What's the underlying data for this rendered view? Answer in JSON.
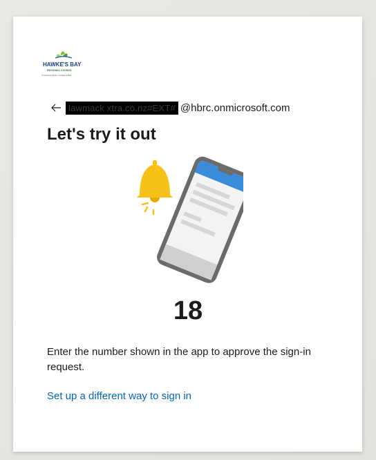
{
  "logo": {
    "line1": "HAWKE'S BAY",
    "line2": "REGIONAL COUNCIL",
    "line3": "Te Kaunihera ā-Rohe o Te Matau-a-Māui"
  },
  "identity": {
    "redacted_text": "lawmack xtra.co.nz#EXT#",
    "domain": "@hbrc.onmicrosoft.com",
    "back_icon": "left-arrow-icon"
  },
  "title": "Let's try it out",
  "illustration": {
    "bell_icon": "bell-icon",
    "phone_icon": "phone-icon",
    "colors": {
      "bell": "#f8c118",
      "phone_frame": "#6b6b6b",
      "phone_header": "#3a8bd9"
    }
  },
  "number": "18",
  "description": "Enter the number shown in the app to approve the sign-in request.",
  "alternate_link": "Set up a different way to sign in",
  "colors": {
    "link": "#0067b8",
    "text": "#1b1b1b"
  }
}
